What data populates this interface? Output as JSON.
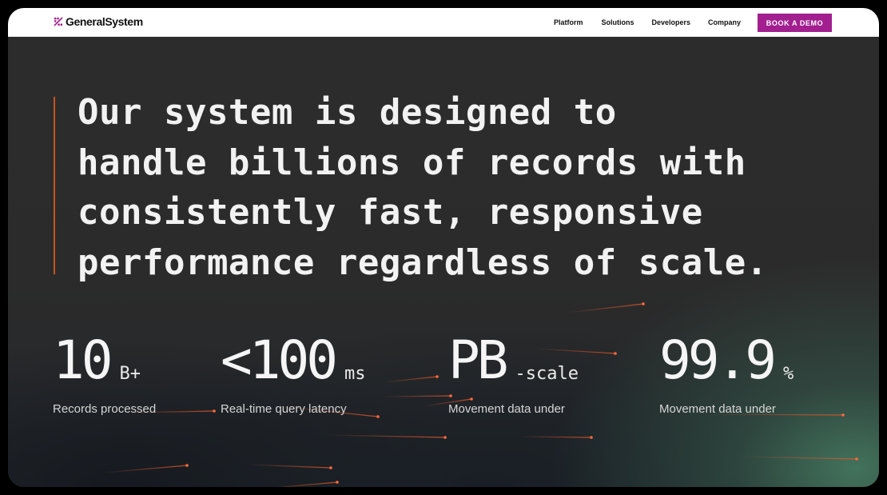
{
  "header": {
    "brand": "GeneralSystem",
    "nav": [
      "Platform",
      "Solutions",
      "Developers",
      "Company"
    ],
    "cta": "BOOK A DEMO"
  },
  "hero": {
    "headline_lines": [
      "Our system is designed to",
      "handle billions of records with",
      "consistently fast, responsive",
      "performance regardless of scale."
    ]
  },
  "stats": [
    {
      "value": "10",
      "unit": "B+",
      "label": "Records processed"
    },
    {
      "value": "<100",
      "unit": "ms",
      "label": "Real-time query latency"
    },
    {
      "value": "PB",
      "unit": "-scale",
      "label": "Movement data under"
    },
    {
      "value": "99.9",
      "unit": "%",
      "label": "Movement data under"
    }
  ],
  "colors": {
    "accent": "#a21f8f",
    "quote_bar": "#c9541f",
    "background": "#2b2b2b",
    "streak": "#e2562a"
  },
  "icons": {
    "logo_mark": "logo-mark-icon"
  }
}
